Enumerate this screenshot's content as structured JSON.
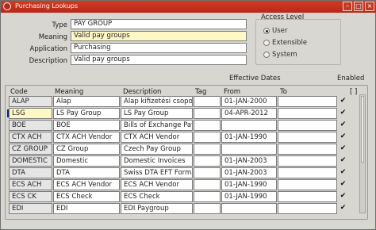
{
  "window": {
    "title": "Purchasing Lookups"
  },
  "header": {
    "fields": [
      {
        "label": "Type",
        "value": "PAY GROUP"
      },
      {
        "label": "Meaning",
        "value": "Valid pay groups"
      },
      {
        "label": "Application",
        "value": "Purchasing"
      },
      {
        "label": "Description",
        "value": "Valid pay groups"
      }
    ]
  },
  "access_level": {
    "title": "Access Level",
    "options": [
      {
        "label": "User",
        "selected": true
      },
      {
        "label": "Extensible",
        "selected": false
      },
      {
        "label": "System",
        "selected": false
      }
    ]
  },
  "table": {
    "section_titles": {
      "effective_dates": "Effective Dates",
      "enabled": "Enabled"
    },
    "headers": {
      "code": "Code",
      "meaning": "Meaning",
      "description": "Description",
      "tag": "Tag",
      "from": "From",
      "to": "To",
      "enabled": "[ ]"
    },
    "rows": [
      {
        "code": "ALAP",
        "meaning": "Alap",
        "description": "Alap kifizetési csoport",
        "tag": "",
        "from": "01-JAN-2000",
        "to": "",
        "enabled": "✔",
        "selected": false
      },
      {
        "code": "LSG",
        "meaning": "LS Pay Group",
        "description": "LS Pay Group",
        "tag": "",
        "from": "04-APR-2012",
        "to": "",
        "enabled": "✔",
        "selected": true
      },
      {
        "code": "BOE",
        "meaning": "BOE",
        "description": "Bills of Exchange Paygr",
        "tag": "",
        "from": "",
        "to": "",
        "enabled": "✔",
        "selected": false
      },
      {
        "code": "CTX ACH",
        "meaning": "CTX ACH Vendor",
        "description": "CTX ACH Vendor",
        "tag": "",
        "from": "01-JAN-1990",
        "to": "",
        "enabled": "✔",
        "selected": false
      },
      {
        "code": "CZ GROUP",
        "meaning": "CZ Group",
        "description": "Czech Pay Group",
        "tag": "",
        "from": "",
        "to": "",
        "enabled": "✔",
        "selected": false
      },
      {
        "code": "DOMESTIC",
        "meaning": "Domestic",
        "description": "Domestic Invoices",
        "tag": "",
        "from": "01-JAN-2003",
        "to": "",
        "enabled": "✔",
        "selected": false
      },
      {
        "code": "DTA",
        "meaning": "DTA",
        "description": "Swiss DTA EFT Format",
        "tag": "",
        "from": "01-JAN-2003",
        "to": "",
        "enabled": "✔",
        "selected": false
      },
      {
        "code": "ECS ACH",
        "meaning": "ECS ACH Vendor",
        "description": "ECS ACH Vendor",
        "tag": "",
        "from": "01-JAN-1990",
        "to": "",
        "enabled": "✔",
        "selected": false
      },
      {
        "code": "ECS CK",
        "meaning": "ECS Check",
        "description": "ECS Check",
        "tag": "",
        "from": "01-JAN-1990",
        "to": "",
        "enabled": "✔",
        "selected": false
      },
      {
        "code": "EDI",
        "meaning": "EDI",
        "description": "EDI Paygroup",
        "tag": "",
        "from": "",
        "to": "",
        "enabled": "✔",
        "selected": false
      }
    ]
  },
  "icons": {
    "window": "oracle-icon",
    "minimize": "minimize-icon",
    "maximize": "maximize-icon",
    "close": "close-icon"
  }
}
